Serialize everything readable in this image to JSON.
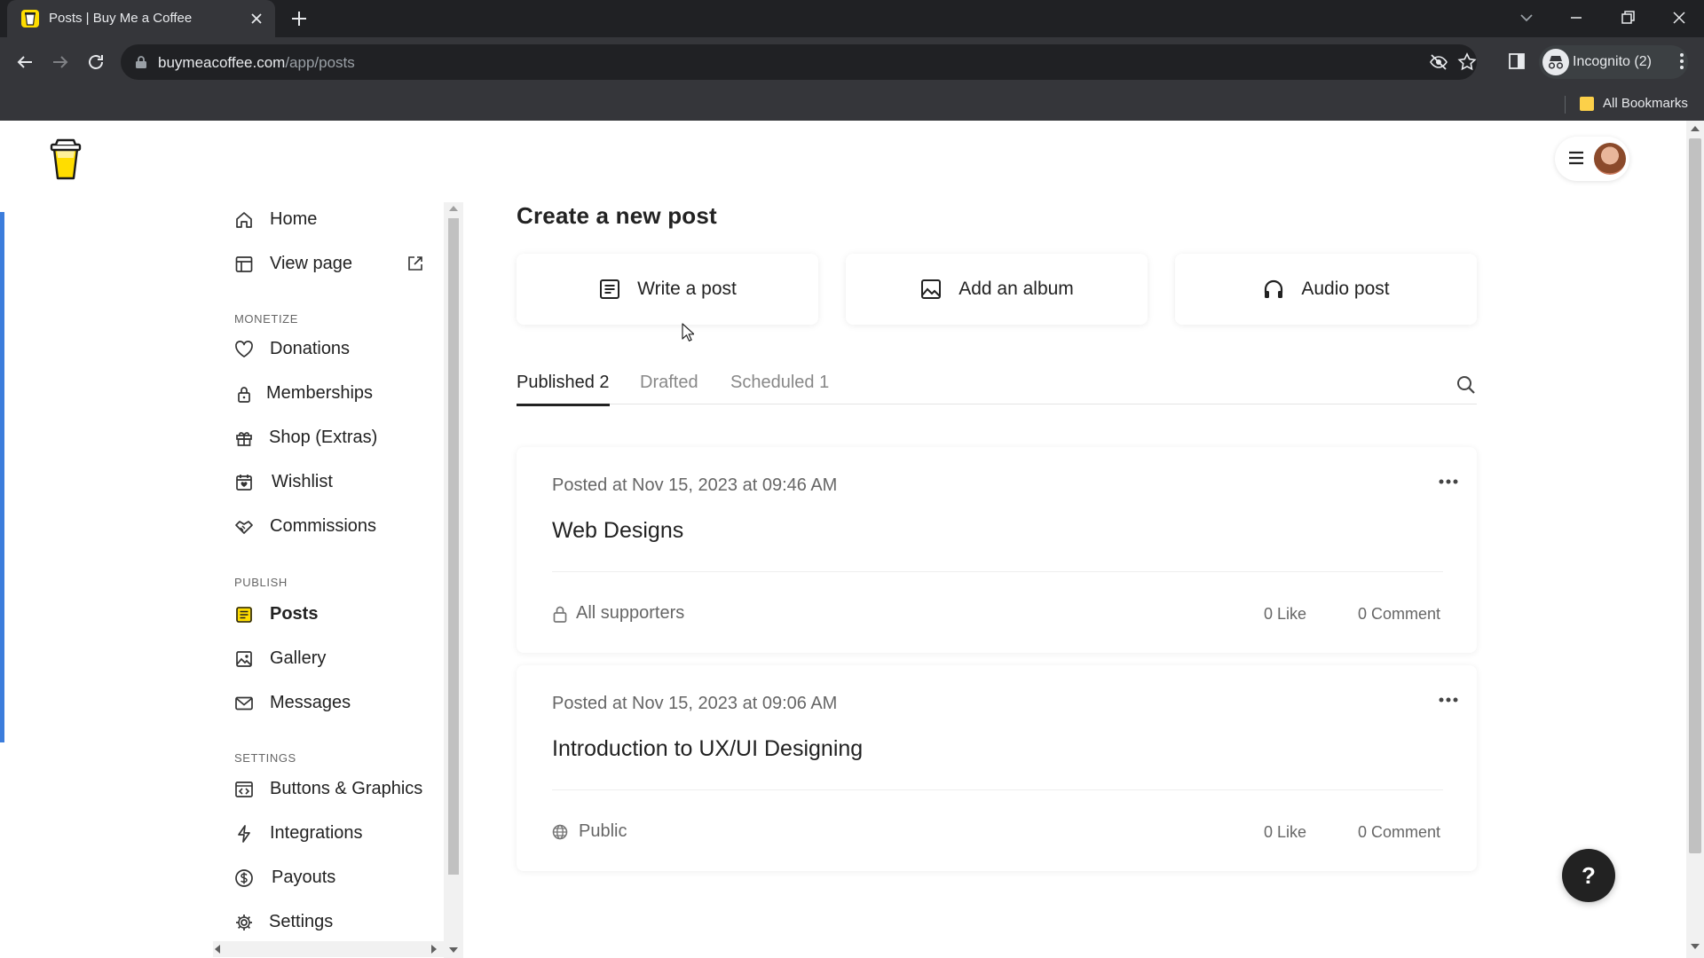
{
  "browser": {
    "tab_title": "Posts | Buy Me a Coffee",
    "url_host": "buymeacoffee.com",
    "url_path": "/app/posts",
    "profile_label": "Incognito (2)",
    "bookmarks_label": "All Bookmarks",
    "accent_color": "#ffdd00"
  },
  "sidebar": {
    "top_items": [
      {
        "label": "Home",
        "icon": "home-icon"
      },
      {
        "label": "View page",
        "icon": "layout-icon"
      }
    ],
    "sections": [
      {
        "label": "MONETIZE",
        "items": [
          {
            "label": "Donations",
            "icon": "heart-icon"
          },
          {
            "label": "Memberships",
            "icon": "lock-icon"
          },
          {
            "label": "Shop (Extras)",
            "icon": "gift-icon"
          },
          {
            "label": "Wishlist",
            "icon": "wishlist-icon"
          },
          {
            "label": "Commissions",
            "icon": "handshake-icon"
          }
        ]
      },
      {
        "label": "PUBLISH",
        "items": [
          {
            "label": "Posts",
            "icon": "posts-icon",
            "active": true
          },
          {
            "label": "Gallery",
            "icon": "image-icon"
          },
          {
            "label": "Messages",
            "icon": "mail-icon"
          }
        ]
      },
      {
        "label": "SETTINGS",
        "items": [
          {
            "label": "Buttons & Graphics",
            "icon": "code-icon"
          },
          {
            "label": "Integrations",
            "icon": "bolt-icon"
          },
          {
            "label": "Payouts",
            "icon": "dollar-icon"
          },
          {
            "label": "Settings",
            "icon": "gear-icon"
          }
        ]
      }
    ]
  },
  "main": {
    "title": "Create a new post",
    "create_options": [
      {
        "label": "Write a post",
        "icon": "document-icon"
      },
      {
        "label": "Add an album",
        "icon": "image-icon"
      },
      {
        "label": "Audio post",
        "icon": "headphones-icon"
      }
    ],
    "tabs": [
      {
        "label": "Published 2",
        "active": true
      },
      {
        "label": "Drafted"
      },
      {
        "label": "Scheduled 1"
      }
    ],
    "posts": [
      {
        "date": "Posted at Nov 15, 2023 at 09:46 AM",
        "title": "Web Designs",
        "visibility": "All supporters",
        "visibility_icon": "lock-icon",
        "likes": "0 Like",
        "comments": "0 Comment"
      },
      {
        "date": "Posted at Nov 15, 2023 at 09:06 AM",
        "title": "Introduction to UX/UI Designing",
        "visibility": "Public",
        "visibility_icon": "globe-icon",
        "likes": "0 Like",
        "comments": "0 Comment"
      }
    ]
  },
  "help_label": "?"
}
